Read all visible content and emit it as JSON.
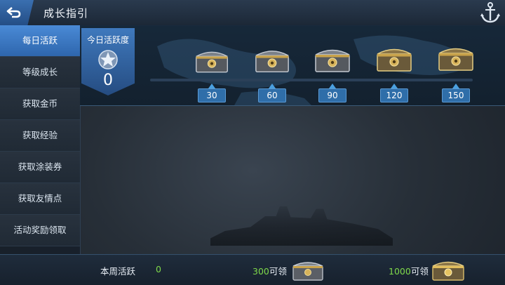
{
  "header": {
    "title": "成长指引"
  },
  "sidebar": {
    "items": [
      {
        "label": "每日活跃",
        "active": true
      },
      {
        "label": "等级成长"
      },
      {
        "label": "获取金币"
      },
      {
        "label": "获取经验"
      },
      {
        "label": "获取涂装券"
      },
      {
        "label": "获取友情点"
      },
      {
        "label": "活动奖励领取"
      }
    ]
  },
  "daily": {
    "label": "今日活跃度",
    "value": "0",
    "progress": 0,
    "milestones": [
      "30",
      "60",
      "90",
      "120",
      "150"
    ]
  },
  "weekly": {
    "label": "本周活跃",
    "value": "0",
    "claims": [
      {
        "amount": "300",
        "label": "可领"
      },
      {
        "amount": "1000",
        "label": "可领"
      }
    ]
  },
  "colors": {
    "accent": "#3a7cc6",
    "highlight": "#7fd94a"
  },
  "icons": {
    "back": "back-arrow-icon",
    "anchor": "anchor-icon",
    "star": "star-rank-icon",
    "chest": "treasure-chest-icon"
  }
}
